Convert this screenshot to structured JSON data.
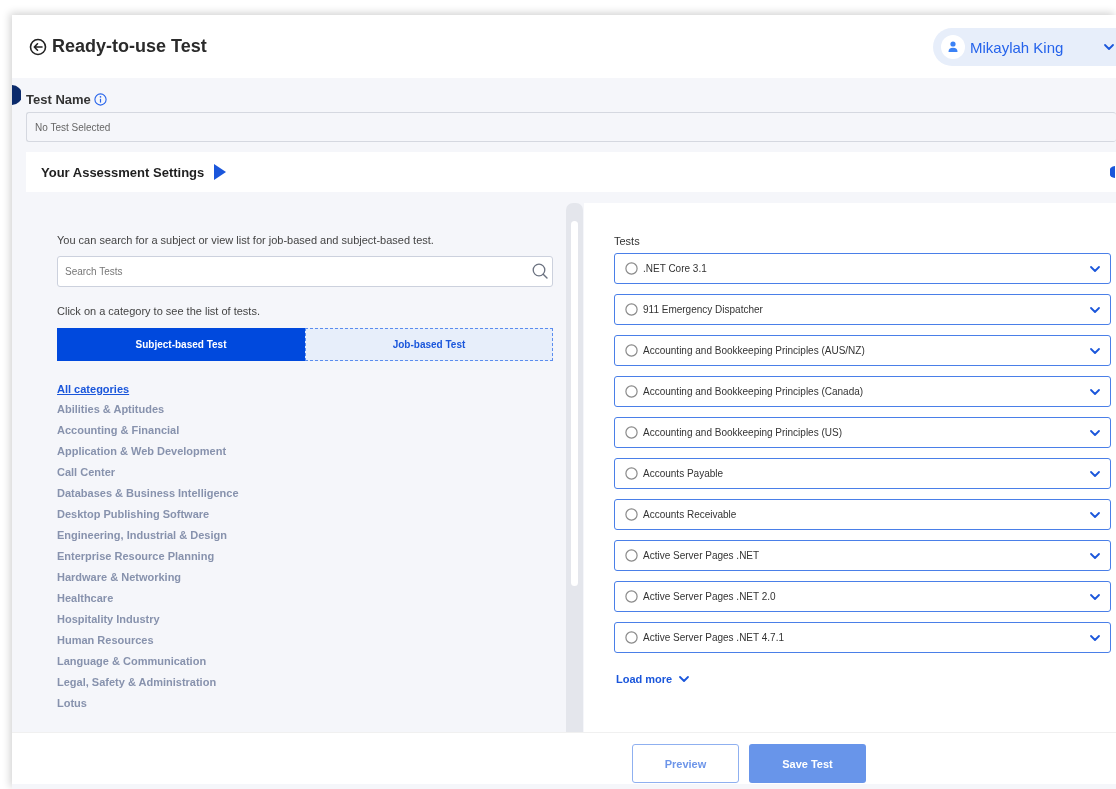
{
  "header": {
    "title": "Ready-to-use Test",
    "user": "Mikaylah King"
  },
  "test_name": {
    "label": "Test Name",
    "value": "No Test Selected"
  },
  "settings": {
    "title": "Your Assessment Settings",
    "expanded": false
  },
  "search_panel": {
    "intro": "You can search for a subject or view list for job-based and subject-based test.",
    "search": {
      "placeholder": "Search Tests"
    },
    "hint": "Click on a category to see the list of tests.",
    "tabs": [
      {
        "label": "Subject-based Test",
        "selected": true
      },
      {
        "label": "Job-based Test",
        "selected": false
      }
    ],
    "all_categories": "All categories",
    "categories": [
      "Abilities & Aptitudes",
      "Accounting & Financial",
      "Application & Web Development",
      "Call Center",
      "Databases & Business Intelligence",
      "Desktop Publishing Software",
      "Engineering, Industrial & Design",
      "Enterprise Resource Planning",
      "Hardware & Networking",
      "Healthcare",
      "Hospitality Industry",
      "Human Resources",
      "Language & Communication",
      "Legal, Safety & Administration",
      "Lotus"
    ]
  },
  "tests": {
    "label": "Tests",
    "items": [
      {
        "name": ".NET Core 3.1",
        "selected": false
      },
      {
        "name": "911 Emergency Dispatcher",
        "selected": false
      },
      {
        "name": "Accounting and Bookkeeping Principles (AUS/NZ)",
        "selected": false
      },
      {
        "name": "Accounting and Bookkeeping Principles (Canada)",
        "selected": false
      },
      {
        "name": "Accounting and Bookkeeping Principles (US)",
        "selected": false
      },
      {
        "name": "Accounts Payable",
        "selected": false
      },
      {
        "name": "Accounts Receivable",
        "selected": false
      },
      {
        "name": "Active Server Pages .NET",
        "selected": false
      },
      {
        "name": "Active Server Pages .NET 2.0",
        "selected": false
      },
      {
        "name": "Active Server Pages .NET 4.7.1",
        "selected": false
      }
    ],
    "load_more": "Load more"
  },
  "footer": {
    "buttons": [
      {
        "label": "Preview",
        "kind": "secondary"
      },
      {
        "label": "Save Test",
        "kind": "primary"
      }
    ]
  }
}
